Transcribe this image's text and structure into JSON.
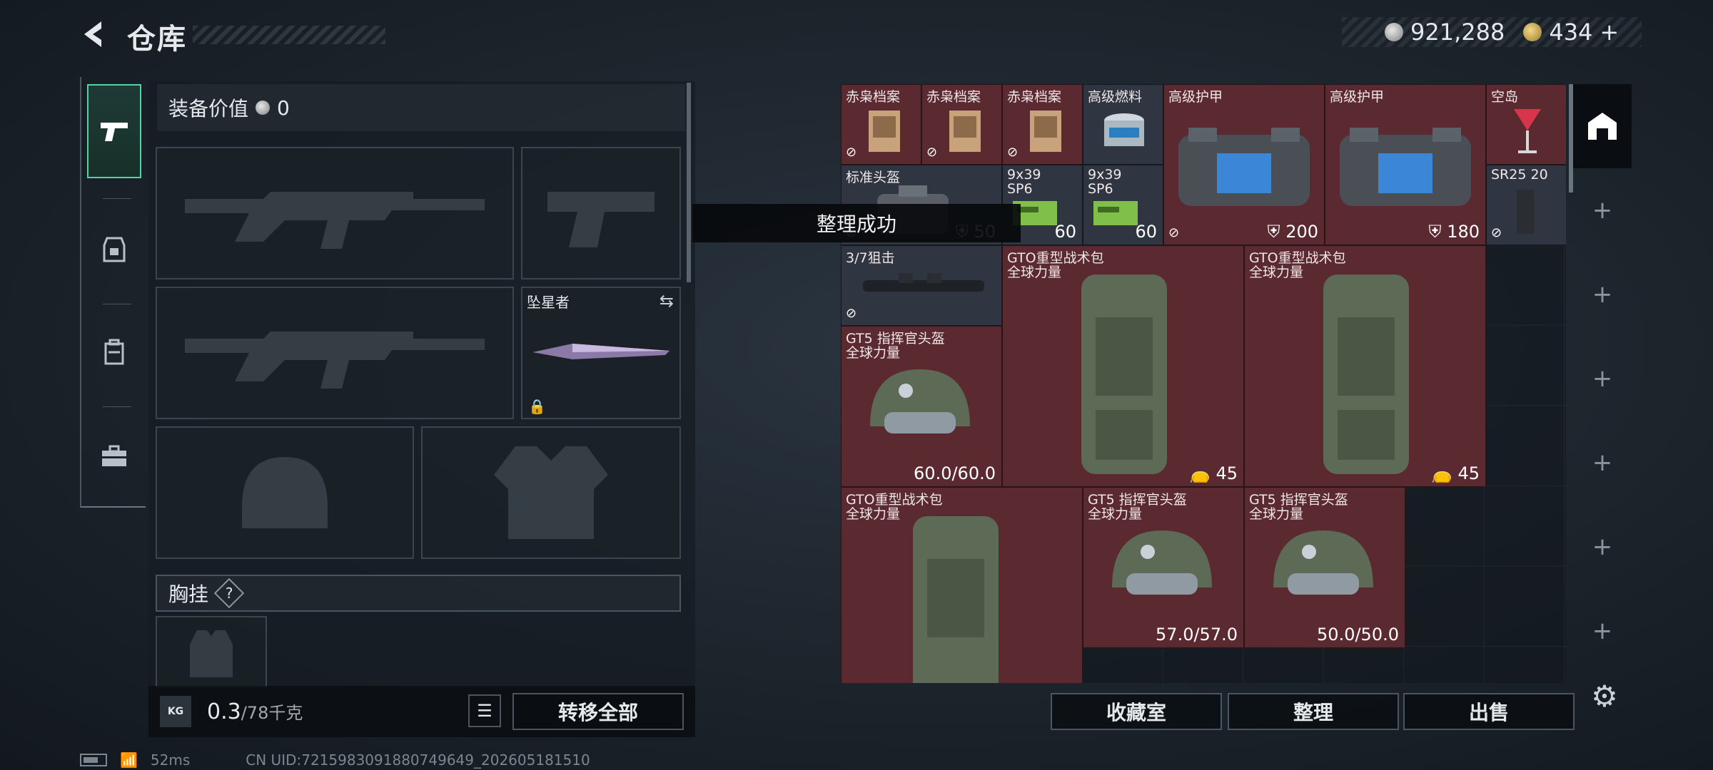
{
  "header": {
    "title": "仓库"
  },
  "currency": {
    "silver": "921,288",
    "gold": "434",
    "gold_plus": "+"
  },
  "nav": {
    "items": [
      "pistol",
      "helmet-body",
      "backpack",
      "toolbox"
    ]
  },
  "equipment": {
    "value_label": "装备价值",
    "value": "0",
    "melee_name": "坠星者",
    "chest_label": "胸挂",
    "chest_help": "?",
    "weight_current": "0.3",
    "weight_max": "/78千克",
    "kg_badge": "KG",
    "transfer_all": "转移全部"
  },
  "toast": "整理成功",
  "warehouse": {
    "items": [
      {
        "t1": "赤枭档案",
        "t2": "",
        "val": "",
        "locked": true
      },
      {
        "t1": "赤枭档案",
        "t2": "",
        "val": "",
        "locked": true
      },
      {
        "t1": "赤枭档案",
        "t2": "",
        "val": "",
        "locked": true
      },
      {
        "t1": "高级燃料",
        "t2": "",
        "val": "",
        "locked": false
      },
      {
        "t1": "高级护甲",
        "t2": "",
        "val": "200",
        "locked": true
      },
      {
        "t1": "高级护甲",
        "t2": "",
        "val": "180",
        "locked": false
      },
      {
        "t1": "空岛",
        "t2": "",
        "val": "",
        "locked": false
      },
      {
        "t1": "标准头盔",
        "t2": "",
        "val": "50",
        "locked": true
      },
      {
        "t1": "9x39",
        "t2": "SP6",
        "val": "60",
        "locked": false
      },
      {
        "t1": "9x39",
        "t2": "SP6",
        "val": "60",
        "locked": false
      },
      {
        "t1": "SR25 20",
        "t2": "",
        "val": "",
        "locked": true
      },
      {
        "t1": "3/7狙击",
        "t2": "",
        "val": "",
        "locked": true
      },
      {
        "t1": "GTO重型战术包",
        "t2": "全球力量",
        "val": "45",
        "locked": false
      },
      {
        "t1": "GTO重型战术包",
        "t2": "全球力量",
        "val": "45",
        "locked": false
      },
      {
        "t1": "GT5 指挥官头盔",
        "t2": "全球力量",
        "val": "60.0/60.0",
        "locked": false
      },
      {
        "t1": "GTO重型战术包",
        "t2": "全球力量",
        "val": "",
        "locked": false
      },
      {
        "t1": "GT5 指挥官头盔",
        "t2": "全球力量",
        "val": "57.0/57.0",
        "locked": false
      },
      {
        "t1": "GT5 指挥官头盔",
        "t2": "全球力量",
        "val": "50.0/50.0",
        "locked": false
      }
    ]
  },
  "actions": {
    "collection": "收藏室",
    "organize": "整理",
    "sell": "出售"
  },
  "status": {
    "ping": "52ms",
    "uid": "CN UID:7215983091880749649_202605181510"
  },
  "colors": {
    "accent": "#4fd6a3",
    "item_red": "#5a2a30",
    "item_gray": "#2f3642"
  }
}
